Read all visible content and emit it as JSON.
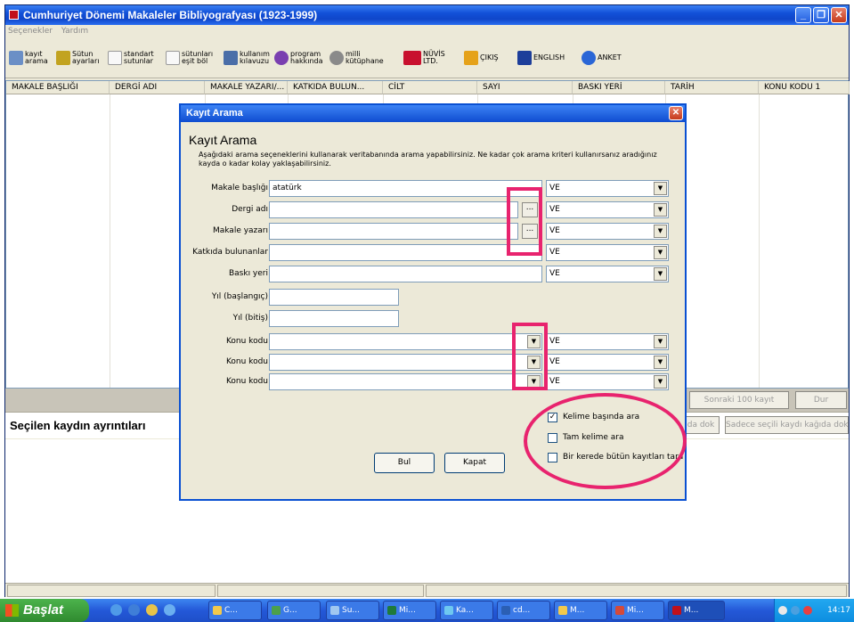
{
  "window": {
    "title": "Cumhuriyet Dönemi Makaleler Bibliyografyası (1923-1999)"
  },
  "menu": [
    "Seçenekler",
    "Yardım"
  ],
  "toolbar": [
    {
      "id": "kayit-arama",
      "line1": "kayıt",
      "line2": "arama",
      "icon": "search-records-icon",
      "color": "#6b8fc6"
    },
    {
      "id": "sutun-ayarlari",
      "line1": "Sütun",
      "line2": "ayarları",
      "icon": "column-settings-icon",
      "color": "#c2a320"
    },
    {
      "id": "standart-sutunlar",
      "line1": "standart",
      "line2": "sutunlar",
      "icon": "standard-columns-icon",
      "color": "#dcdcdc"
    },
    {
      "id": "sutunlari-esit-bol",
      "line1": "sütunları",
      "line2": "eşit böl",
      "icon": "equal-columns-icon",
      "color": "#dcdcdc"
    },
    {
      "id": "kullanim-kilavuzu",
      "line1": "kullanım",
      "line2": "kılavuzu",
      "icon": "manual-icon",
      "color": "#4a6ea8"
    },
    {
      "id": "program-hakkinda",
      "line1": "program",
      "line2": "hakkında",
      "icon": "about-icon",
      "color": "#7a3fb0"
    },
    {
      "id": "milli-kutuphane",
      "line1": "milli",
      "line2": "kütüphane",
      "icon": "library-icon",
      "color": "#8a8a8a"
    },
    {
      "id": "nuvis",
      "line1": "NÜVİS",
      "line2": "LTD.",
      "icon": "nuvis-logo-icon",
      "color": "#c8102e"
    },
    {
      "id": "cikis",
      "line1": "ÇIKIŞ",
      "line2": "",
      "icon": "exit-icon",
      "color": "#e5a21a"
    },
    {
      "id": "english",
      "line1": "ENGLISH",
      "line2": "",
      "icon": "uk-flag-icon",
      "color": "#1d3e9a"
    },
    {
      "id": "anket",
      "line1": "ANKET",
      "line2": "",
      "icon": "help-icon",
      "color": "#2a66d6"
    }
  ],
  "grid": {
    "columns": [
      "MAKALE BAŞLIĞI",
      "DERGİ ADI",
      "MAKALE YAZARI/...",
      "KATKIDA BULUN...",
      "CİLT",
      "SAYI",
      "BASKI YERİ",
      "TARİH",
      "KONU KODU 1"
    ]
  },
  "buttons": {
    "next100": "Sonraki 100 kayıt",
    "stop": "Dur",
    "print_doc": "da dok",
    "print_selected": "Sadece seçili kaydı kağıda dok"
  },
  "details": {
    "title": "Seçilen kaydın ayrıntıları"
  },
  "dialog": {
    "title": "Kayıt Arama",
    "heading": "Kayıt Arama",
    "description": "Aşağıdaki arama seçeneklerini kullanarak veritabanında arama yapabilirsiniz. Ne kadar çok arama kriteri kullanırsanız aradığınız kayda o kadar kolay yaklaşabilirsiniz.",
    "fields": [
      {
        "label": "Makale başlığı",
        "value": "atatürk",
        "operator": "VE"
      },
      {
        "label": "Dergi adı",
        "value": "",
        "operator": "VE",
        "browse": "..."
      },
      {
        "label": "Makale yazarı",
        "value": "",
        "operator": "VE",
        "browse": "..."
      },
      {
        "label": "Katkıda bulunanlar",
        "value": "",
        "operator": "VE"
      },
      {
        "label": "Baskı yeri",
        "value": "",
        "operator": "VE"
      },
      {
        "label": "Yıl (başlangıç)",
        "value": ""
      },
      {
        "label": "Yıl (bitiş)",
        "value": ""
      },
      {
        "label": "Konu kodu",
        "value": "",
        "operator": "VE"
      },
      {
        "label": "Konu kodu",
        "value": "",
        "operator": "VE"
      },
      {
        "label": "Konu kodu",
        "value": "",
        "operator": "VE"
      }
    ],
    "options": [
      {
        "label": "Kelime başında ara",
        "checked": true
      },
      {
        "label": "Tam kelime ara",
        "checked": false
      },
      {
        "label": "Bir kerede bütün kayıtları tara",
        "checked": false
      }
    ],
    "find_button": "Bul",
    "close_button": "Kapat"
  },
  "taskbar": {
    "start": "Başlat",
    "tasks": [
      "C...",
      "G...",
      "Su...",
      "Mi...",
      "Ka...",
      "cd...",
      "M...",
      "Mi...",
      "M..."
    ],
    "clock": "14:17"
  }
}
